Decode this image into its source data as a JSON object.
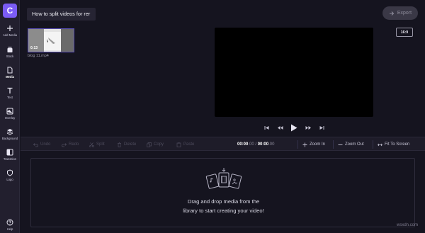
{
  "app": {
    "logo_letter": "C",
    "project_title": "How to split videos for rer",
    "export_label": "Export",
    "aspect_ratio": "16:9",
    "accent_color": "#7b5cf5"
  },
  "sidebar": {
    "items": [
      {
        "label": "Add Media",
        "icon": "plus-icon"
      },
      {
        "label": "Stock",
        "icon": "stock-icon"
      },
      {
        "label": "Media",
        "icon": "media-icon"
      },
      {
        "label": "Text",
        "icon": "text-icon"
      },
      {
        "label": "Overlay",
        "icon": "overlay-icon"
      },
      {
        "label": "Background",
        "icon": "layers-icon"
      },
      {
        "label": "Transition",
        "icon": "transition-icon"
      },
      {
        "label": "Logo",
        "icon": "shield-icon"
      },
      {
        "label": "Help",
        "icon": "help-icon"
      }
    ]
  },
  "media": {
    "filename": "blog 11.mp4",
    "duration": "0:13"
  },
  "toolbar": {
    "undo": "Undo",
    "redo": "Redo",
    "split": "Split",
    "delete": "Delete",
    "copy": "Copy",
    "paste": "Paste",
    "time_current": "00:00",
    "time_current_frac": ".00",
    "time_sep": " / ",
    "time_total": "00:00",
    "time_total_frac": ".00",
    "zoom_in": "Zoom In",
    "zoom_out": "Zoom Out",
    "fit_to_screen": "Fit To Screen"
  },
  "timeline": {
    "drop_line1": "Drag and drop media from the",
    "drop_line2": "library to start creating your video!"
  },
  "watermark": "wsxdn.com"
}
